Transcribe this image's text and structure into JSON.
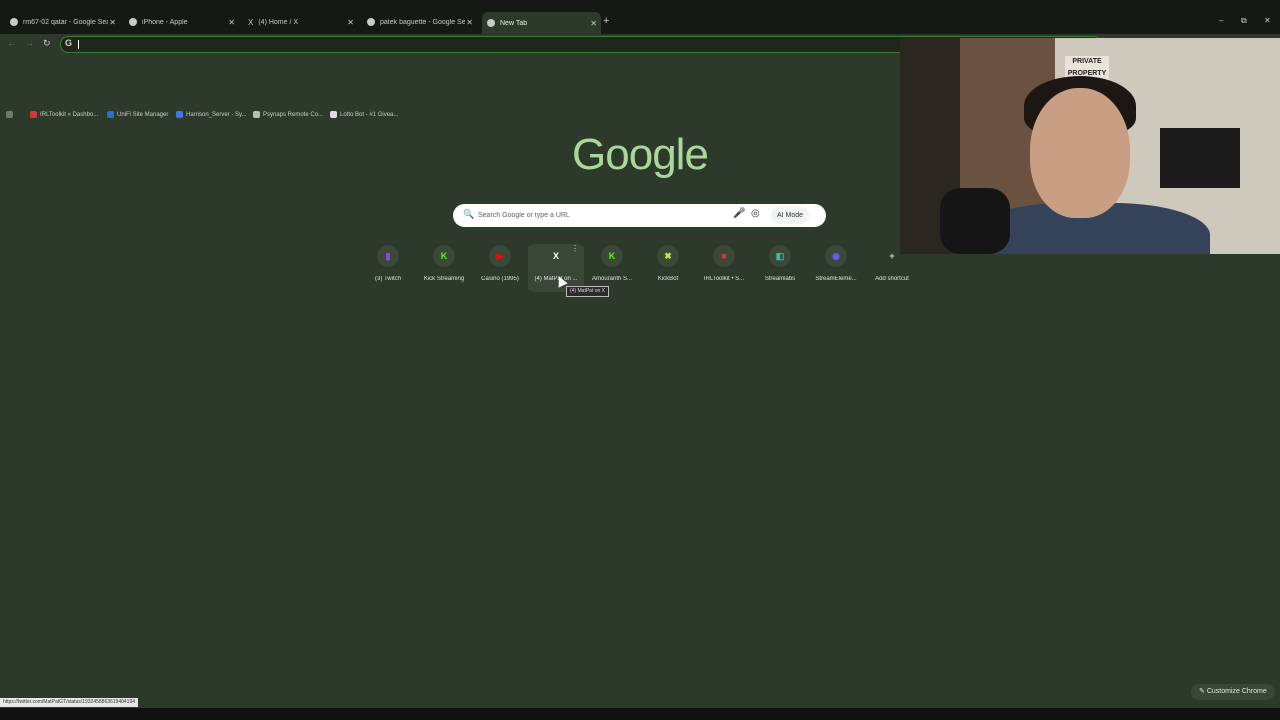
{
  "tabs": [
    {
      "title": "rm67-02 qatar - Google Search",
      "close": "✕"
    },
    {
      "title": "iPhone - Apple",
      "close": "✕"
    },
    {
      "title": "(4) Home / X",
      "close": "✕"
    },
    {
      "title": "patek baguette - Google Search",
      "close": "✕"
    },
    {
      "title": "New Tab",
      "close": "✕"
    }
  ],
  "new_tab_glyph": "+",
  "window_controls": {
    "minimize": "–",
    "restore": "⧉",
    "close": "✕"
  },
  "toolbar": {
    "back": "←",
    "forward": "→",
    "reload": "↻",
    "omnibox_icon": "G",
    "omnibox_value": ""
  },
  "bookmarks": [
    {
      "label": "IRLToolkit « Dashbo...",
      "color": "#d23a3a"
    },
    {
      "label": "UniFi Site Manager",
      "color": "#2a6fd6"
    },
    {
      "label": "Harrison_Server - Sy...",
      "color": "#3b7be0"
    },
    {
      "label": "Psynaps Remote Co...",
      "color": "#bbbbbb"
    },
    {
      "label": "Lotto Bot - #1 Givea...",
      "color": "#dddddd"
    }
  ],
  "logo_text": "Google",
  "search": {
    "placeholder": "Search Google or type a URL",
    "search_glyph": "🔍",
    "mic_glyph": "🎤",
    "lens_glyph": "◎",
    "ai_mode_label": "AI Mode"
  },
  "shortcuts": [
    {
      "label": "(3) Twitch",
      "glyph": "▮",
      "color": "#9146ff"
    },
    {
      "label": "Kick Streaming",
      "glyph": "K",
      "color": "#53fc18"
    },
    {
      "label": "Casino (1995)",
      "glyph": "▶",
      "color": "#ff0000"
    },
    {
      "label": "(4) MatPat on ...",
      "glyph": "X",
      "color": "#ffffff"
    },
    {
      "label": "Amouranth S...",
      "glyph": "K",
      "color": "#53fc18"
    },
    {
      "label": "KickBot",
      "glyph": "✖",
      "color": "#b6f03a"
    },
    {
      "label": "IRLToolkit • S...",
      "glyph": "■",
      "color": "#d23a3a"
    },
    {
      "label": "Streamlabs",
      "glyph": "◧",
      "color": "#31c3a2"
    },
    {
      "label": "StreamEleme...",
      "glyph": "◉",
      "color": "#6a5cff"
    },
    {
      "label": "Add shortcut",
      "glyph": "+",
      "color": "#c8e6bd"
    }
  ],
  "shortcut_menu_glyph": "⋮",
  "tooltip": "(4) MatPat on X",
  "webcam_sign": "PRIVATE PROPERTY",
  "status_url": "https://twitter.com/MatPatGT/status/1932458863619404194",
  "customize_label": "Customize Chrome",
  "customize_glyph": "✎"
}
